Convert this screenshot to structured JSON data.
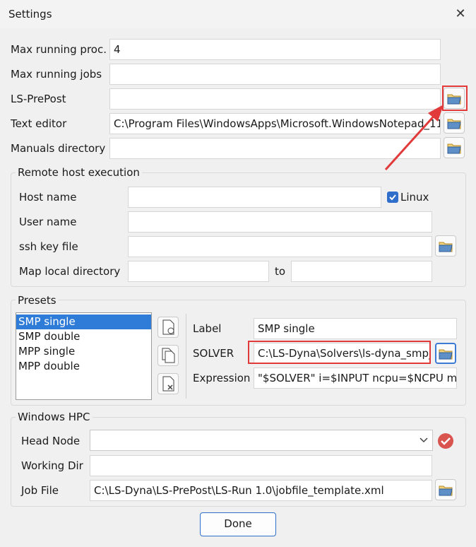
{
  "window": {
    "title": "Settings"
  },
  "general": {
    "max_running_proc_label": "Max running proc.",
    "max_running_proc_value": "4",
    "max_running_jobs_label": "Max running jobs",
    "max_running_jobs_value": "",
    "ls_prepost_label": "LS-PrePost",
    "ls_prepost_value": "",
    "text_editor_label": "Text editor",
    "text_editor_value": "C:\\Program Files\\WindowsApps\\Microsoft.WindowsNotepad_11",
    "manuals_dir_label": "Manuals directory",
    "manuals_dir_value": ""
  },
  "remote": {
    "group_title": "Remote host execution",
    "host_name_label": "Host name",
    "host_name_value": "",
    "linux_label": "Linux",
    "linux_checked": true,
    "user_name_label": "User name",
    "user_name_value": "",
    "ssh_key_label": "ssh key file",
    "ssh_key_value": "",
    "map_local_label": "Map local directory",
    "map_local_value": "",
    "to_label": "to",
    "to_value": ""
  },
  "presets": {
    "group_title": "Presets",
    "items": [
      "SMP single",
      "SMP double",
      "MPP single",
      "MPP double"
    ],
    "selected_index": 0,
    "label_label": "Label",
    "label_value": "SMP single",
    "solver_label": "SOLVER",
    "solver_value": "C:\\LS-Dyna\\Solvers\\ls-dyna_smp_s",
    "expression_label": "Expression",
    "expression_value": "\"$SOLVER\" i=$INPUT ncpu=$NCPU me"
  },
  "hpc": {
    "group_title": "Windows HPC",
    "head_node_label": "Head Node",
    "head_node_value": "",
    "working_dir_label": "Working Dir",
    "working_dir_value": "",
    "job_file_label": "Job File",
    "job_file_value": "C:\\LS-Dyna\\LS-PrePost\\LS-Run 1.0\\jobfile_template.xml"
  },
  "footer": {
    "done_label": "Done"
  },
  "colors": {
    "accent": "#2f6fcb",
    "annotation": "#e23a3a",
    "status_error": "#d9534f"
  }
}
